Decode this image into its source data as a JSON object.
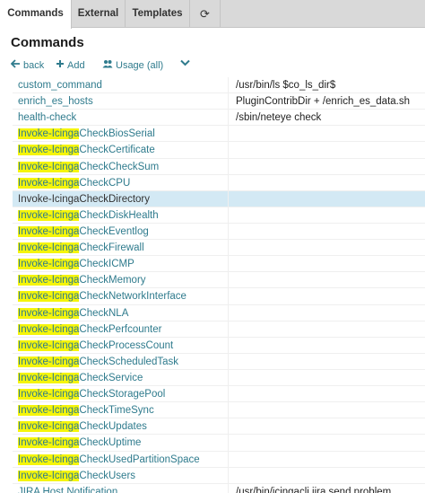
{
  "tabs": {
    "commands": "Commands",
    "external": "External",
    "templates": "Templates",
    "refresh_icon": "⟳"
  },
  "page": {
    "title": "Commands"
  },
  "actions": {
    "back": "back",
    "add": "Add",
    "usage": "Usage (all)",
    "more_icon": "chevron-down"
  },
  "colors": {
    "link": "#2f7b8d",
    "highlight": "#f5f50a",
    "selected_row": "#d3e9f4"
  },
  "rows": [
    {
      "name": "custom_command",
      "command": "/usr/bin/ls $co_ls_dir$"
    },
    {
      "name": "enrich_es_hosts",
      "command": "PluginContribDir + /enrich_es_data.sh"
    },
    {
      "name": "health-check",
      "command": "/sbin/neteye check"
    },
    {
      "prefix": "Invoke-Icinga",
      "suffix": "CheckBiosSerial",
      "command": ""
    },
    {
      "prefix": "Invoke-Icinga",
      "suffix": "CheckCertificate",
      "command": ""
    },
    {
      "prefix": "Invoke-Icinga",
      "suffix": "CheckCheckSum",
      "command": ""
    },
    {
      "prefix": "Invoke-Icinga",
      "suffix": "CheckCPU",
      "command": ""
    },
    {
      "prefix": "Invoke-Icinga",
      "suffix": "CheckDirectory",
      "command": ""
    },
    {
      "prefix": "Invoke-Icinga",
      "suffix": "CheckDiskHealth",
      "command": ""
    },
    {
      "prefix": "Invoke-Icinga",
      "suffix": "CheckEventlog",
      "command": ""
    },
    {
      "prefix": "Invoke-Icinga",
      "suffix": "CheckFirewall",
      "command": ""
    },
    {
      "prefix": "Invoke-Icinga",
      "suffix": "CheckICMP",
      "command": ""
    },
    {
      "prefix": "Invoke-Icinga",
      "suffix": "CheckMemory",
      "command": ""
    },
    {
      "prefix": "Invoke-Icinga",
      "suffix": "CheckNetworkInterface",
      "command": ""
    },
    {
      "prefix": "Invoke-Icinga",
      "suffix": "CheckNLA",
      "command": ""
    },
    {
      "prefix": "Invoke-Icinga",
      "suffix": "CheckPerfcounter",
      "command": ""
    },
    {
      "prefix": "Invoke-Icinga",
      "suffix": "CheckProcessCount",
      "command": ""
    },
    {
      "prefix": "Invoke-Icinga",
      "suffix": "CheckScheduledTask",
      "command": ""
    },
    {
      "prefix": "Invoke-Icinga",
      "suffix": "CheckService",
      "command": ""
    },
    {
      "prefix": "Invoke-Icinga",
      "suffix": "CheckStoragePool",
      "command": ""
    },
    {
      "prefix": "Invoke-Icinga",
      "suffix": "CheckTimeSync",
      "command": ""
    },
    {
      "prefix": "Invoke-Icinga",
      "suffix": "CheckUpdates",
      "command": ""
    },
    {
      "prefix": "Invoke-Icinga",
      "suffix": "CheckUptime",
      "command": ""
    },
    {
      "prefix": "Invoke-Icinga",
      "suffix": "CheckUsedPartitionSpace",
      "command": ""
    },
    {
      "prefix": "Invoke-Icinga",
      "suffix": "CheckUsers",
      "command": ""
    },
    {
      "name": "JIRA Host Notification",
      "command": "/usr/bin/icingacli jira send problem"
    }
  ]
}
